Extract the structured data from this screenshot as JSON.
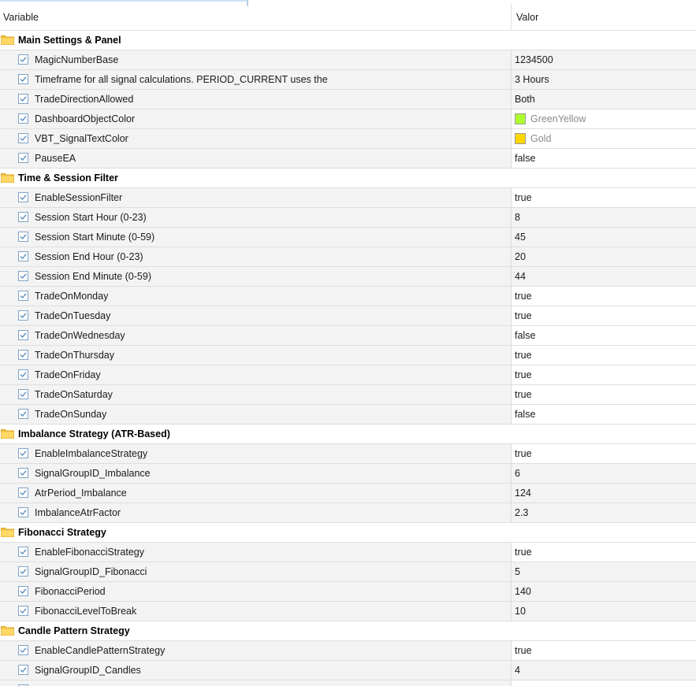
{
  "header": {
    "variable_label": "Variable",
    "value_label": "Valor"
  },
  "colors": {
    "folder": "#f4c542",
    "row_background": "#f3f3f3",
    "checkbox_border": "#7fa4c8",
    "disabled_text": "#8a8a8a"
  },
  "groups": [
    {
      "title": "Main Settings & Panel",
      "params": [
        {
          "name": "MagicNumberBase",
          "value": "1234500"
        },
        {
          "name": "Timeframe for all signal calculations. PERIOD_CURRENT uses the",
          "value": "3 Hours"
        },
        {
          "name": "TradeDirectionAllowed",
          "value": "Both"
        },
        {
          "name": "DashboardObjectColor",
          "value": "GreenYellow",
          "swatch": "#adff2f",
          "disabled": true
        },
        {
          "name": "VBT_SignalTextColor",
          "value": "Gold",
          "swatch": "#ffd700",
          "disabled": true
        },
        {
          "name": "PauseEA",
          "value": "false"
        }
      ]
    },
    {
      "title": "Time & Session Filter",
      "params": [
        {
          "name": "EnableSessionFilter",
          "value": "true"
        },
        {
          "name": "Session Start Hour (0-23)",
          "value": "8"
        },
        {
          "name": "Session Start Minute (0-59)",
          "value": "45"
        },
        {
          "name": "Session End Hour (0-23)",
          "value": "20"
        },
        {
          "name": "Session End Minute (0-59)",
          "value": "44"
        },
        {
          "name": "TradeOnMonday",
          "value": "true"
        },
        {
          "name": "TradeOnTuesday",
          "value": "true"
        },
        {
          "name": "TradeOnWednesday",
          "value": "false"
        },
        {
          "name": "TradeOnThursday",
          "value": "true"
        },
        {
          "name": "TradeOnFriday",
          "value": "true"
        },
        {
          "name": "TradeOnSaturday",
          "value": "true"
        },
        {
          "name": "TradeOnSunday",
          "value": "false"
        }
      ]
    },
    {
      "title": "Imbalance Strategy (ATR-Based)",
      "params": [
        {
          "name": "EnableImbalanceStrategy",
          "value": "true"
        },
        {
          "name": "SignalGroupID_Imbalance",
          "value": "6"
        },
        {
          "name": "AtrPeriod_Imbalance",
          "value": "124"
        },
        {
          "name": "ImbalanceAtrFactor",
          "value": "2.3"
        }
      ]
    },
    {
      "title": "Fibonacci Strategy",
      "params": [
        {
          "name": "EnableFibonacciStrategy",
          "value": "true"
        },
        {
          "name": "SignalGroupID_Fibonacci",
          "value": "5"
        },
        {
          "name": "FibonacciPeriod",
          "value": "140"
        },
        {
          "name": "FibonacciLevelToBreak",
          "value": "10"
        }
      ]
    },
    {
      "title": "Candle Pattern Strategy",
      "params": [
        {
          "name": "EnableCandlePatternStrategy",
          "value": "true"
        },
        {
          "name": "SignalGroupID_Candles",
          "value": "4"
        }
      ]
    }
  ]
}
